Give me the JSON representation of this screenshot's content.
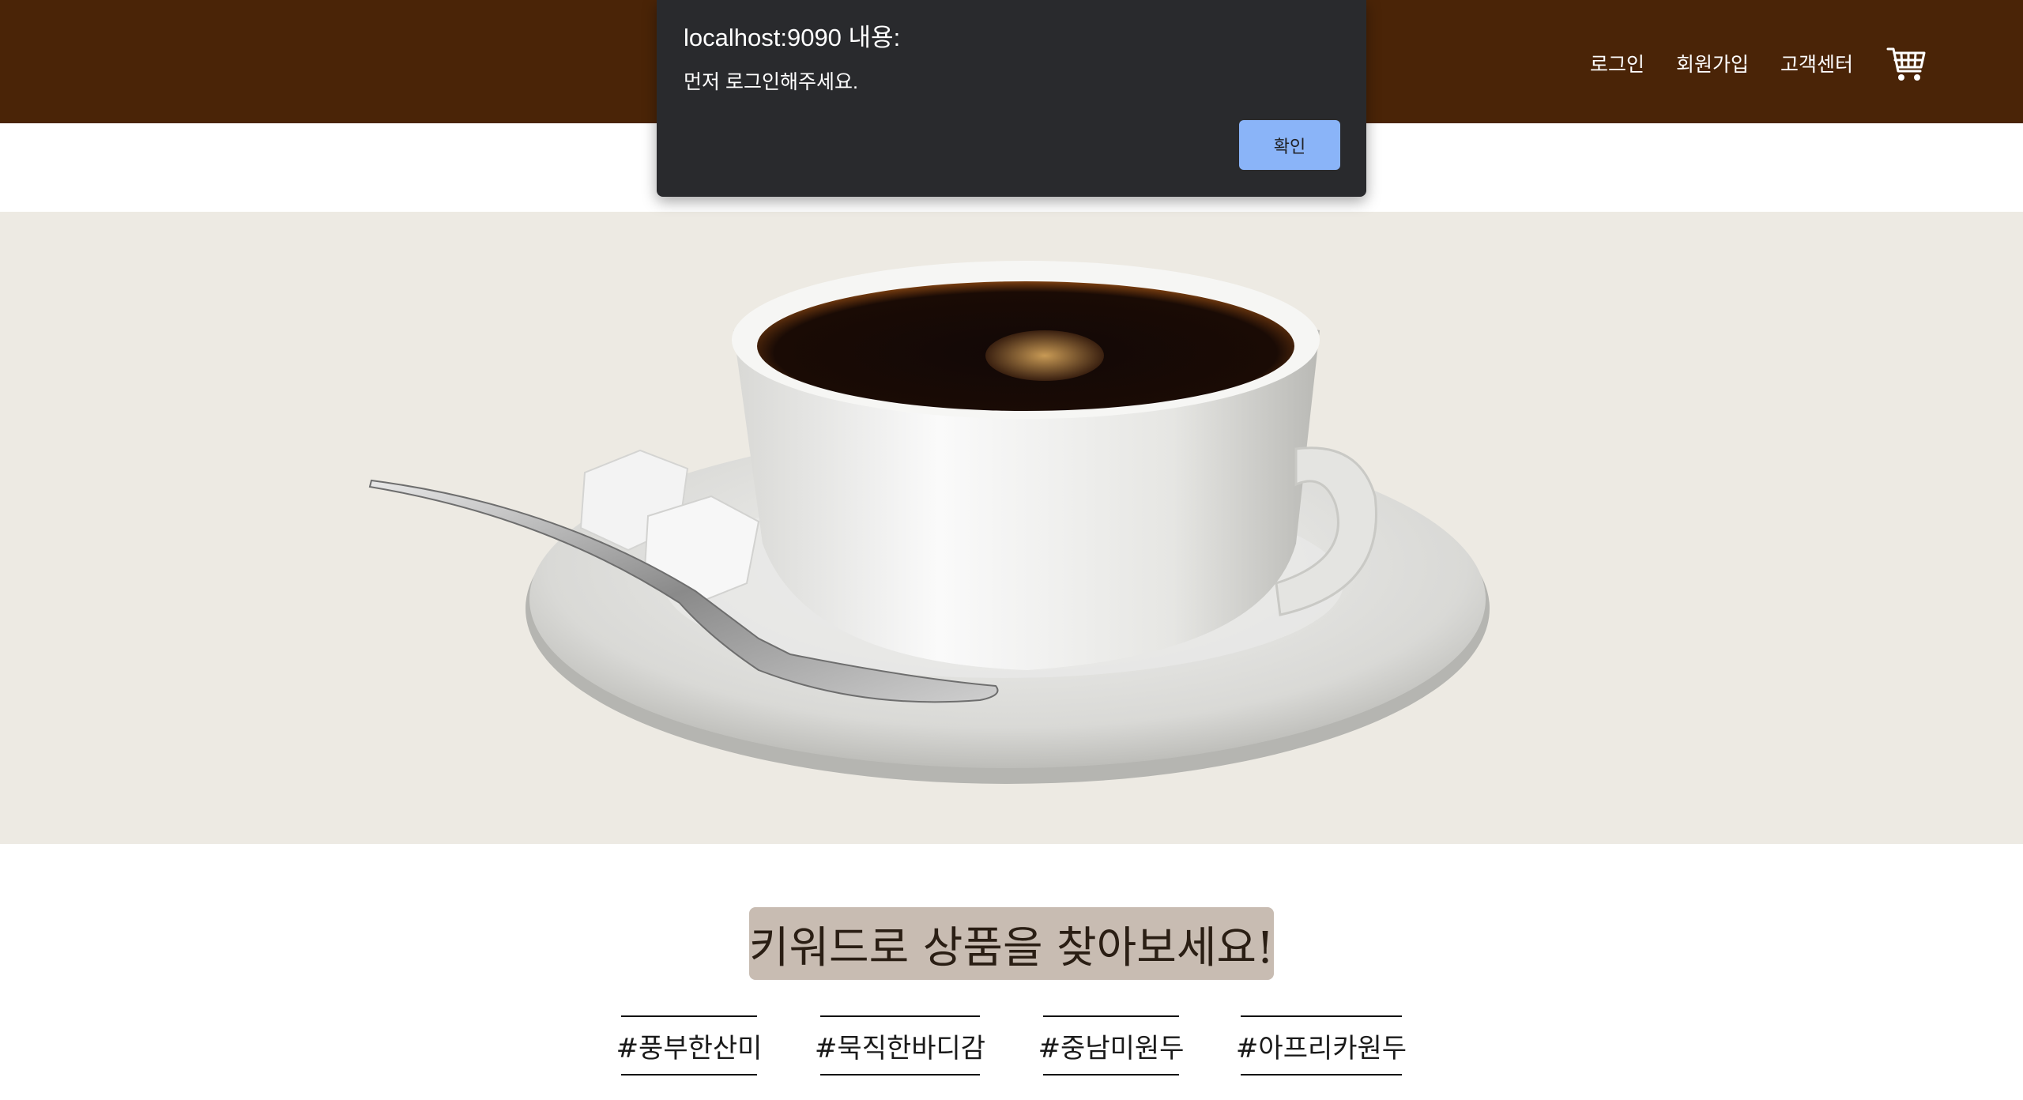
{
  "header": {
    "nav": [
      {
        "label": "로그인"
      },
      {
        "label": "회원가입"
      },
      {
        "label": "고객센터"
      }
    ],
    "cart_icon": "shopping-cart-icon",
    "background_color": "#4a2407"
  },
  "hero": {
    "image": "coffee-cup-on-saucer-with-spoon-and-sugar-cubes",
    "background_color": "#edeae3"
  },
  "keywords": {
    "title": "키워드로 상품을 찾아보세요!",
    "tags": [
      "#풍부한산미",
      "#묵직한바디감",
      "#중남미원두",
      "#아프리카원두"
    ]
  },
  "dialog": {
    "title": "localhost:9090 내용:",
    "message": "먼저 로그인해주세요.",
    "ok_label": "확인",
    "button_color": "#8ab4f8"
  }
}
